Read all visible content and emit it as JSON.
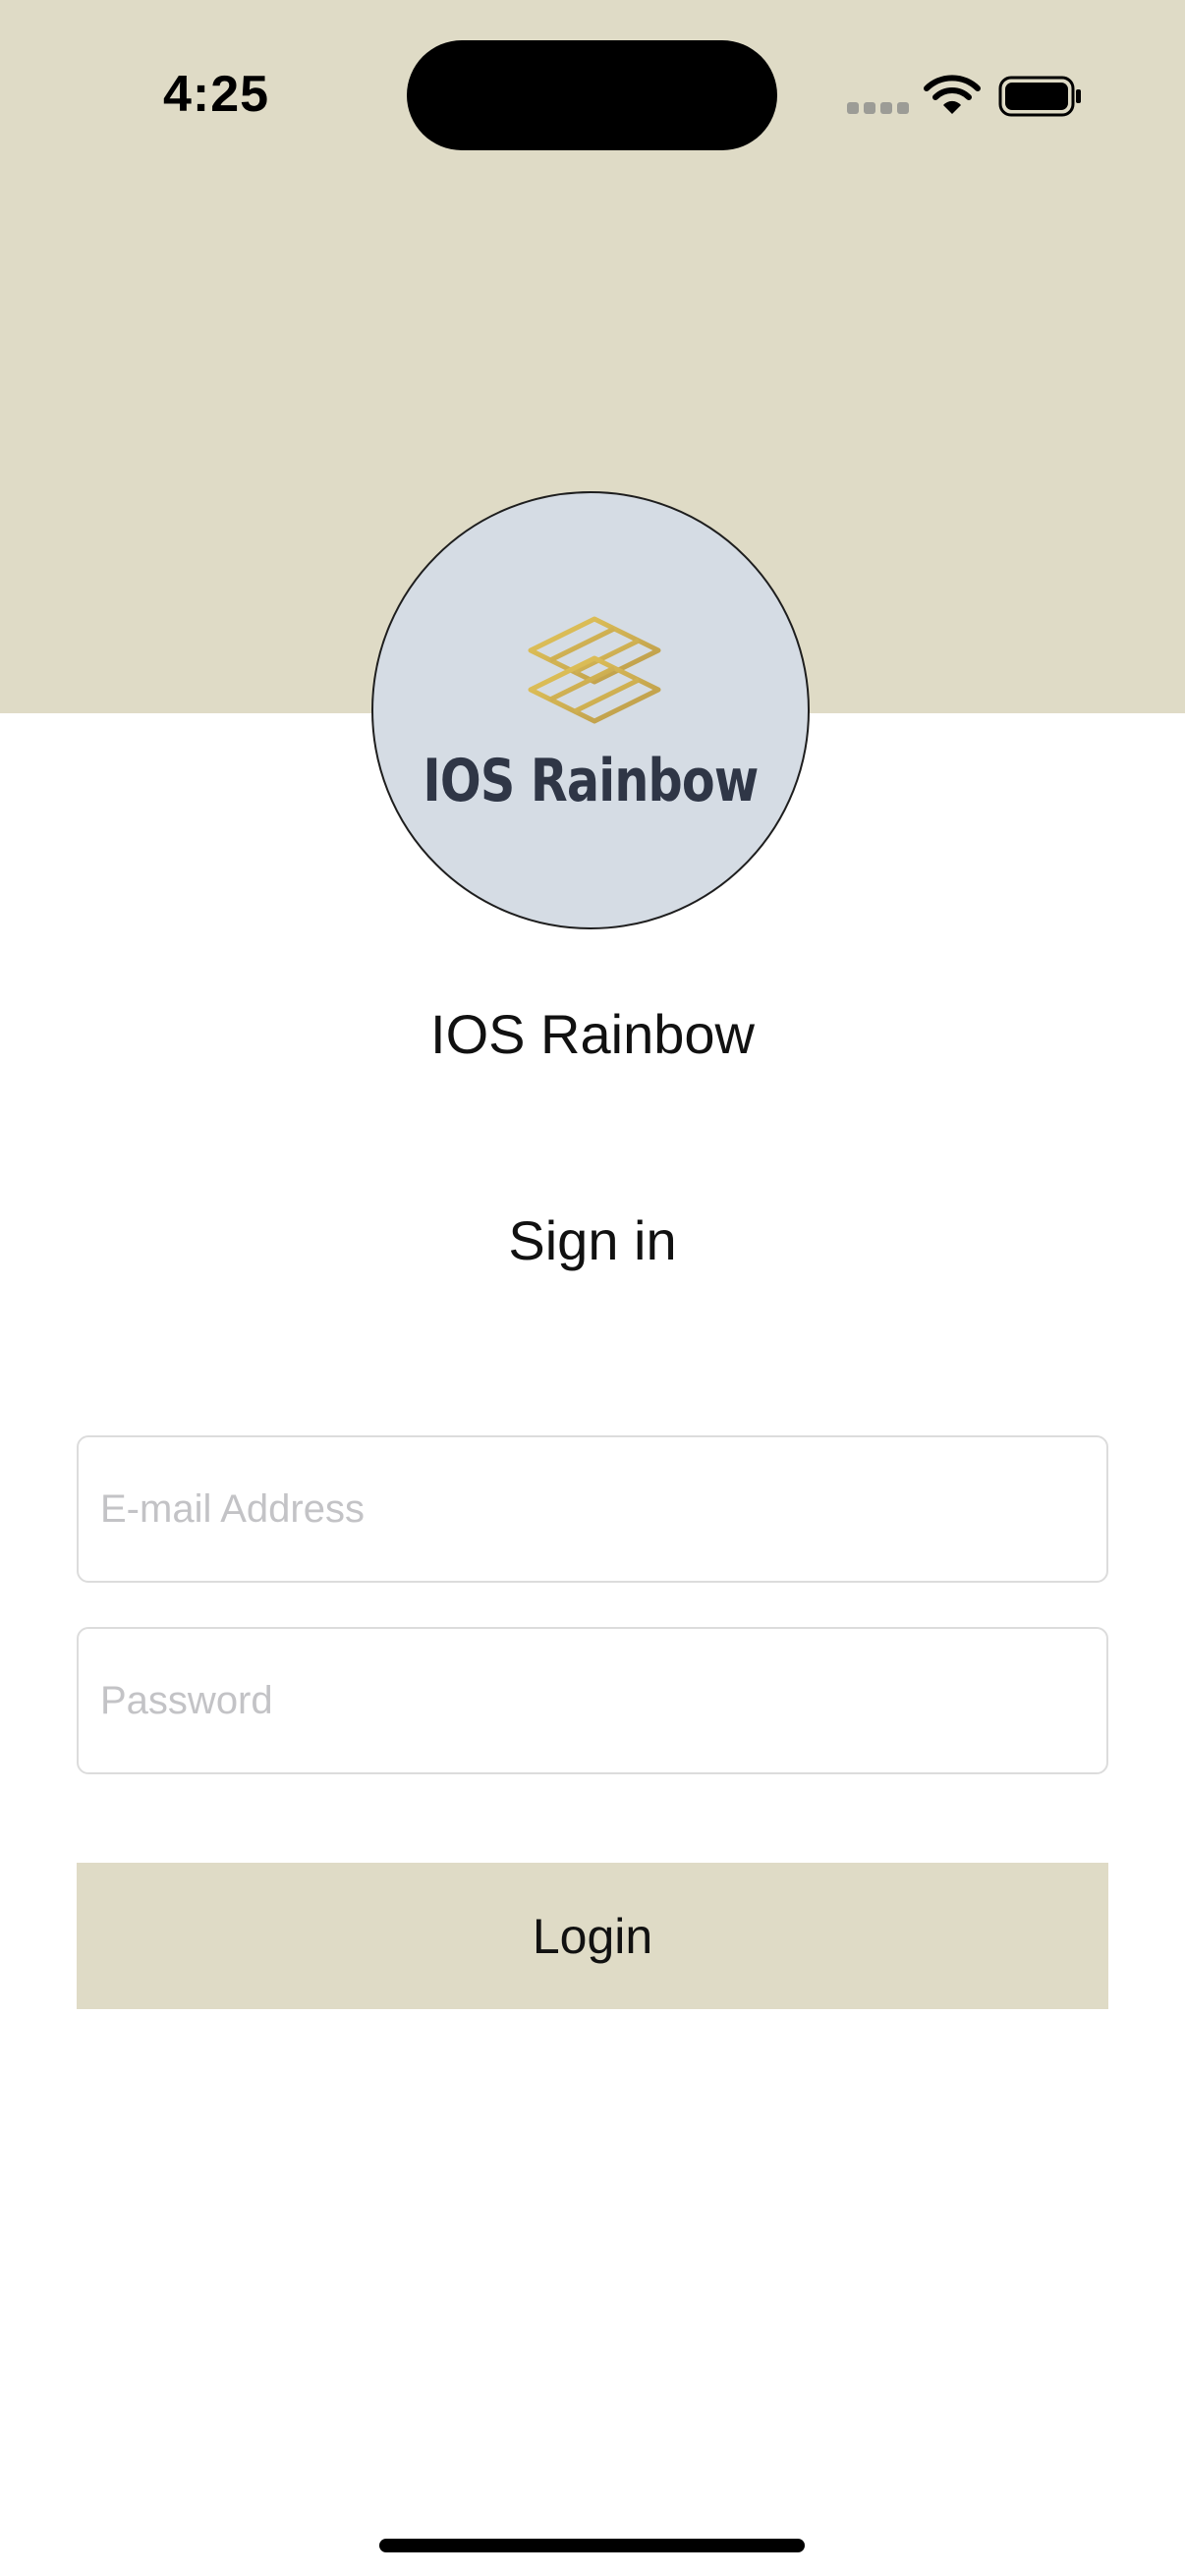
{
  "status_bar": {
    "time": "4:25",
    "icons": [
      "cellular-signal-icon",
      "wifi-icon",
      "battery-icon"
    ]
  },
  "colors": {
    "header_background": "#dfdbc6",
    "login_button_background": "#dfdbc6",
    "avatar_background": "#d5dce4",
    "logo_gold": "#d4b24a",
    "logo_text": "#2f3646"
  },
  "logo": {
    "text": "IOS Rainbow",
    "icon": "stacked-tiles-logo-icon"
  },
  "app_name": "IOS Rainbow",
  "signin": {
    "title": "Sign in",
    "email_placeholder": "E-mail Address",
    "email_value": "",
    "password_placeholder": "Password",
    "password_value": "",
    "login_label": "Login"
  }
}
